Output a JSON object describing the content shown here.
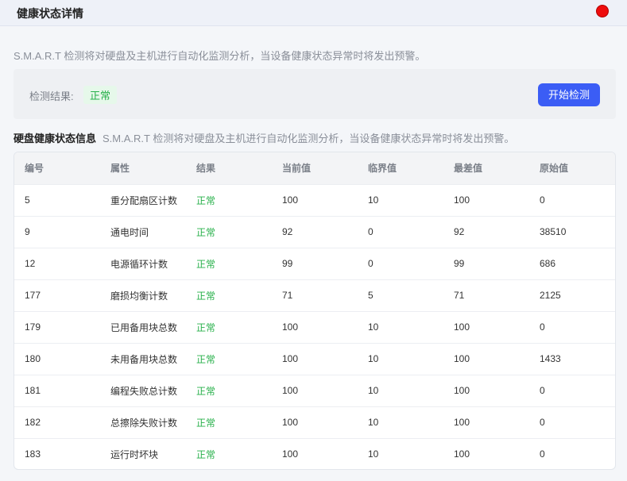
{
  "window": {
    "title": "健康状态详情"
  },
  "description": "S.M.A.R.T 检测将对硬盘及主机进行自动化监测分析，当设备健康状态异常时将发出预警。",
  "result": {
    "label": "检测结果:",
    "status": "正常",
    "button_label": "开始检测"
  },
  "section": {
    "title": "硬盘健康状态信息",
    "description": "S.M.A.R.T 检测将对硬盘及主机进行自动化监测分析，当设备健康状态异常时将发出预警。"
  },
  "table": {
    "headers": [
      "编号",
      "属性",
      "结果",
      "当前值",
      "临界值",
      "最差值",
      "原始值"
    ],
    "rows": [
      [
        "5",
        "重分配扇区计数",
        "正常",
        "100",
        "10",
        "100",
        "0"
      ],
      [
        "9",
        "通电时间",
        "正常",
        "92",
        "0",
        "92",
        "38510"
      ],
      [
        "12",
        "电源循环计数",
        "正常",
        "99",
        "0",
        "99",
        "686"
      ],
      [
        "177",
        "磨损均衡计数",
        "正常",
        "71",
        "5",
        "71",
        "2125"
      ],
      [
        "179",
        "已用备用块总数",
        "正常",
        "100",
        "10",
        "100",
        "0"
      ],
      [
        "180",
        "未用备用块总数",
        "正常",
        "100",
        "10",
        "100",
        "1433"
      ],
      [
        "181",
        "编程失败总计数",
        "正常",
        "100",
        "10",
        "100",
        "0"
      ],
      [
        "182",
        "总擦除失败计数",
        "正常",
        "100",
        "10",
        "100",
        "0"
      ],
      [
        "183",
        "运行时坏块",
        "正常",
        "100",
        "10",
        "100",
        "0"
      ]
    ]
  },
  "colors": {
    "accent": "#3b5df5",
    "ok": "#27b04a",
    "close": "#ee0d0d"
  }
}
